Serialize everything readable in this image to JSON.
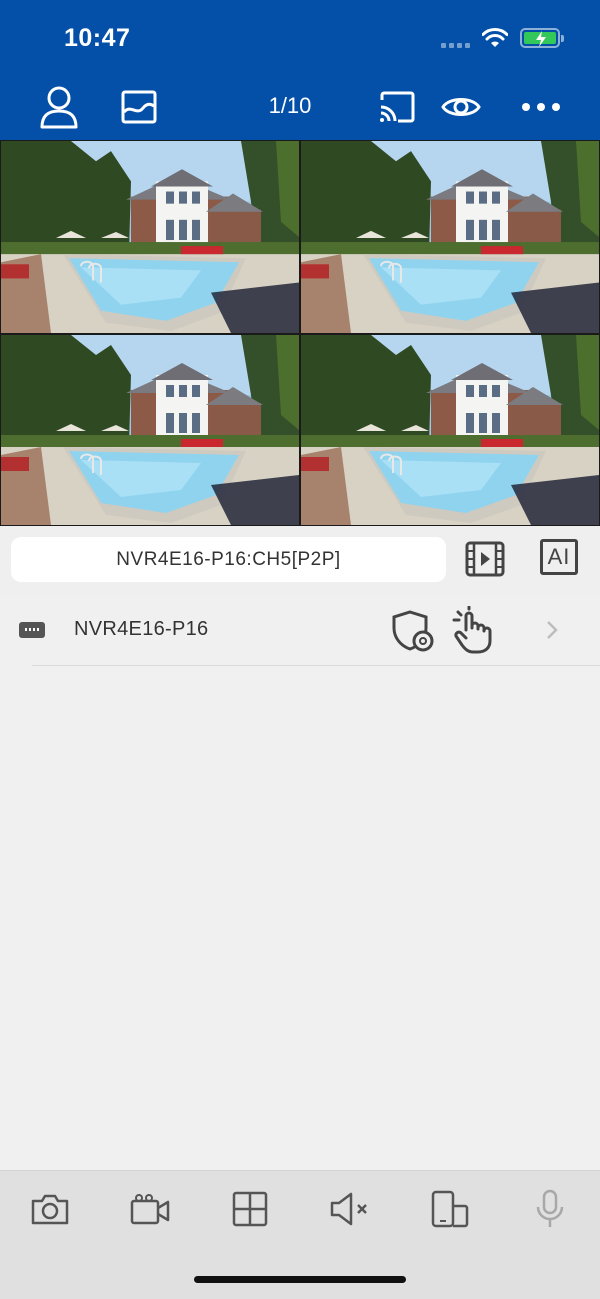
{
  "status_bar": {
    "time": "10:47"
  },
  "header": {
    "page_counter": "1/10"
  },
  "channel": {
    "name": "NVR4E16-P16:CH5[P2P]",
    "ai_label": "AI"
  },
  "device_list": {
    "items": [
      {
        "name": "NVR4E16-P16"
      }
    ]
  },
  "colors": {
    "header_bg": "#0450a8",
    "selection": "#3fb3e6",
    "battery": "#34c759"
  }
}
